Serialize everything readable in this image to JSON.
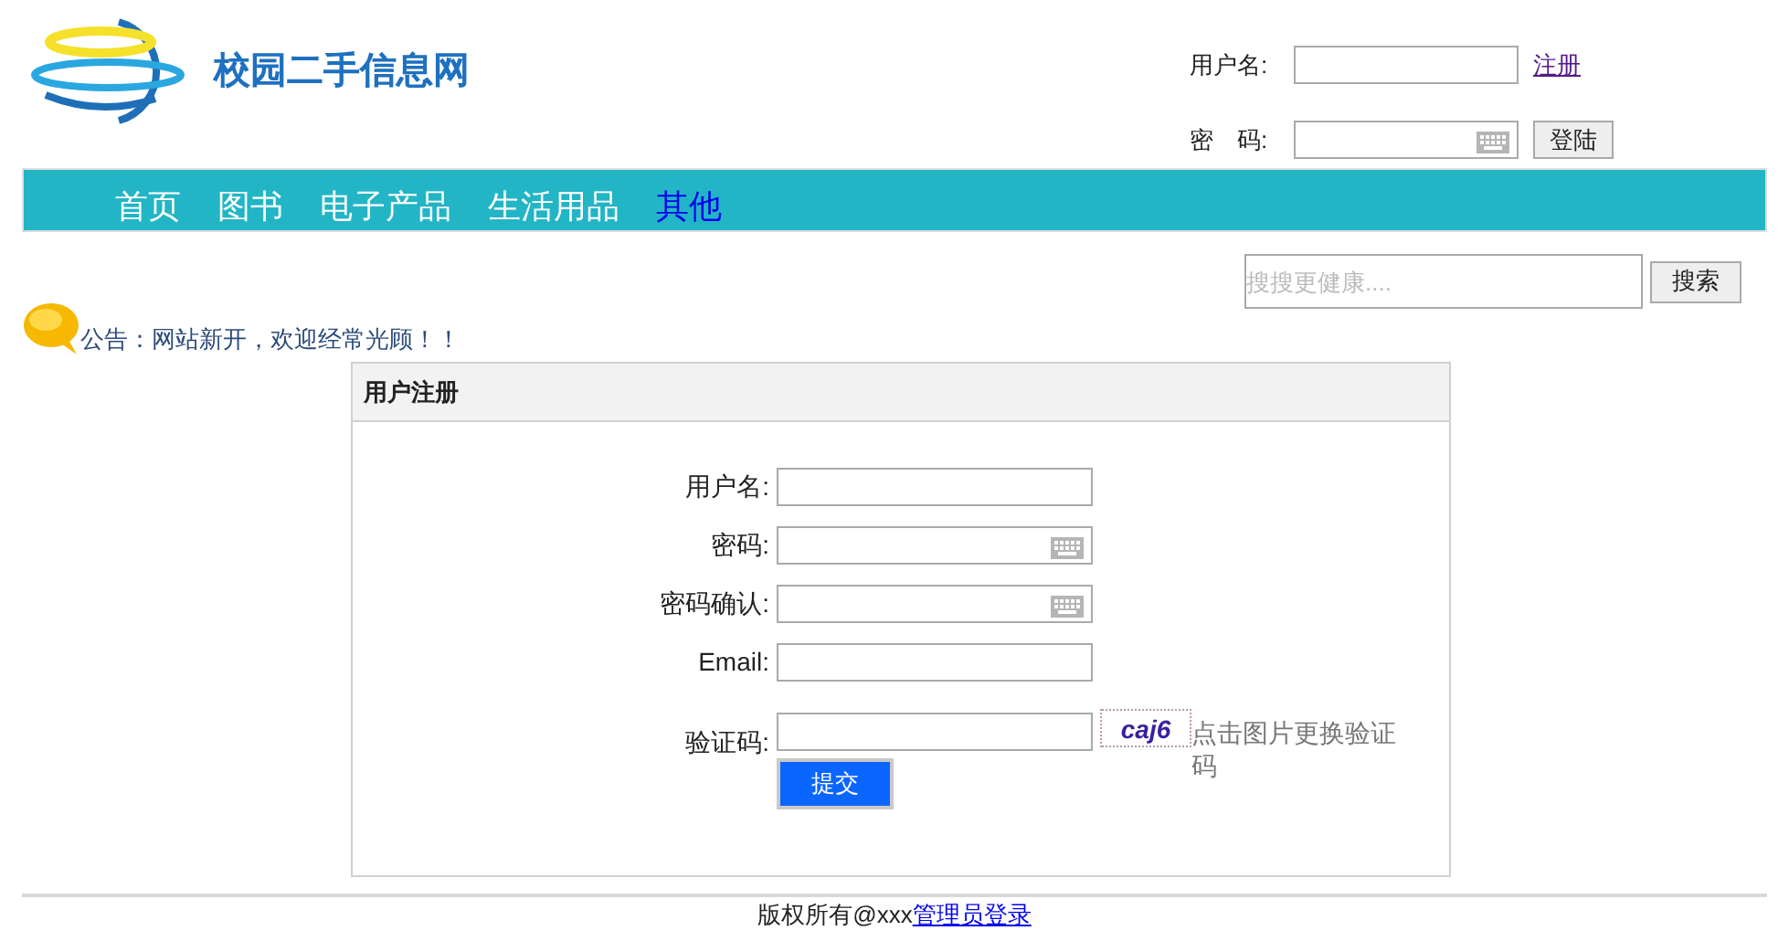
{
  "logo": {
    "title": "校园二手信息网"
  },
  "login": {
    "username_label": "用户名:",
    "register_link": "注册",
    "password_label": "密　码:",
    "login_button": "登陆"
  },
  "nav": [
    {
      "label": "首页",
      "selected": false
    },
    {
      "label": "图书",
      "selected": false
    },
    {
      "label": "电子产品",
      "selected": false
    },
    {
      "label": "生活用品",
      "selected": false
    },
    {
      "label": "其他",
      "selected": true
    }
  ],
  "search": {
    "placeholder": "搜搜更健康....",
    "button": "搜索"
  },
  "notice": "公告：网站新开，欢迎经常光顾！！",
  "register": {
    "title": "用户注册",
    "fields": [
      {
        "label": "用户名:",
        "kind": "text"
      },
      {
        "label": "密码:",
        "kind": "password"
      },
      {
        "label": "密码确认:",
        "kind": "password"
      },
      {
        "label": "Email:",
        "kind": "text"
      },
      {
        "label": "验证码:",
        "kind": "captcha",
        "captcha": "caj6",
        "hint": "点击图片更换验证码"
      }
    ],
    "submit": "提交"
  },
  "footer": {
    "text": "版权所有@xxx",
    "link": "管理员登录"
  }
}
